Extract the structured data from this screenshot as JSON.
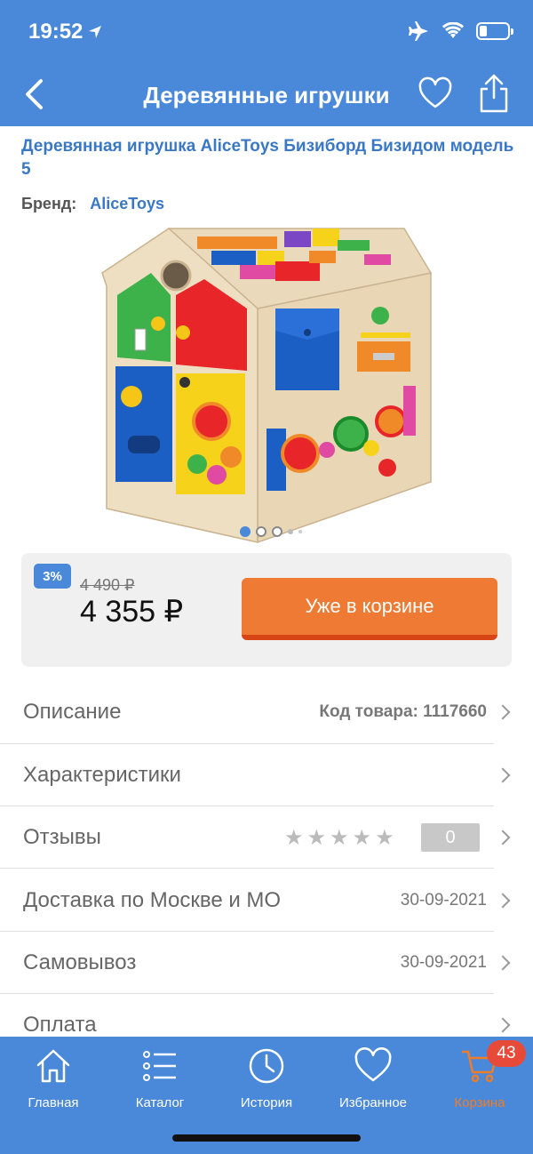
{
  "status": {
    "time": "19:52"
  },
  "nav": {
    "title": "Деревянные игрушки"
  },
  "product": {
    "title": "Деревянная игрушка AliceToys Бизиборд Бизидом модель 5",
    "brand_label": "Бренд:",
    "brand": "AliceToys",
    "image_count": 5,
    "active_image": 1
  },
  "price": {
    "discount": "3%",
    "old_price": "4 490 ₽",
    "new_price": "4 355 ₽",
    "cart_button": "Уже в корзине"
  },
  "details": {
    "description_label": "Описание",
    "sku": "Код товара: 1117660",
    "characteristics_label": "Характеристики",
    "reviews_label": "Отзывы",
    "reviews_count": "0",
    "rating": 0,
    "delivery_label": "Доставка по Москве и МО",
    "delivery_date": "30-09-2021",
    "pickup_label": "Самовывоз",
    "pickup_date": "30-09-2021",
    "payment_label": "Оплата"
  },
  "tabbar": {
    "home": "Главная",
    "catalog": "Каталог",
    "history": "История",
    "favorites": "Избранное",
    "cart": "Корзина",
    "cart_count": "43"
  },
  "colors": {
    "primary": "#4a89d9",
    "accent_orange": "#ee7a33",
    "badge_red": "#e84a3a",
    "link_blue": "#3a78c6"
  }
}
